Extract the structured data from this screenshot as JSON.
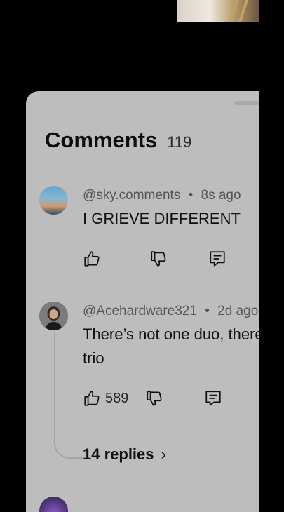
{
  "sheet": {
    "title": "Comments",
    "count": "119"
  },
  "comments": [
    {
      "author": "@sky.comments",
      "separator": "•",
      "time": "8s ago",
      "text_lines": [
        "I GRIEVE DIFFERENT"
      ],
      "likes": ""
    },
    {
      "author": "@Acehardware321",
      "separator": "•",
      "time": "2d ago",
      "text_lines": [
        "There’s not one duo, there’s a",
        "trio"
      ],
      "likes": "589",
      "replies_label": "14 replies"
    }
  ],
  "icons": {
    "like": "thumbs-up-icon",
    "dislike": "thumbs-down-icon",
    "reply": "comment-reply-icon",
    "replies_chevron": "chevron-right-icon"
  },
  "colors": {
    "sheet_bg": "#bdbdbd",
    "page_bg": "#000000"
  }
}
